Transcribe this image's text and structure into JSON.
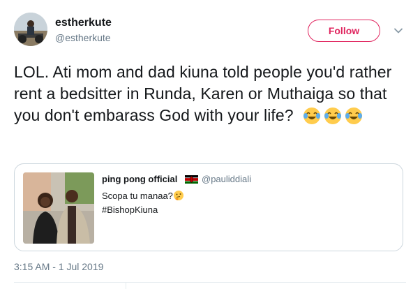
{
  "author": {
    "name": "estherkute",
    "handle": "@estherkute",
    "avatar": "avatar-photo"
  },
  "follow": {
    "label": "Follow",
    "accent": "#e0245e"
  },
  "menu": {
    "icon": "chevron-down-icon"
  },
  "tweet": {
    "text": "LOL. Ati mom and dad kiuna told people you'd rather rent a bedsitter in Runda, Karen or Muthaiga so that you don't embarass God with your life?",
    "emojis": [
      "face-with-tears-of-joy",
      "face-with-tears-of-joy",
      "face-with-tears-of-joy"
    ]
  },
  "quoted": {
    "name": "ping pong official",
    "flag": "kenya-flag-icon",
    "handle": "@pauliddiali",
    "line1": "Scopa tu manaa?",
    "line1_emoji": "thinking-face",
    "line2": "#BishopKiuna",
    "image": "couple-photo"
  },
  "timestamp": "3:15 AM - 1 Jul 2019"
}
